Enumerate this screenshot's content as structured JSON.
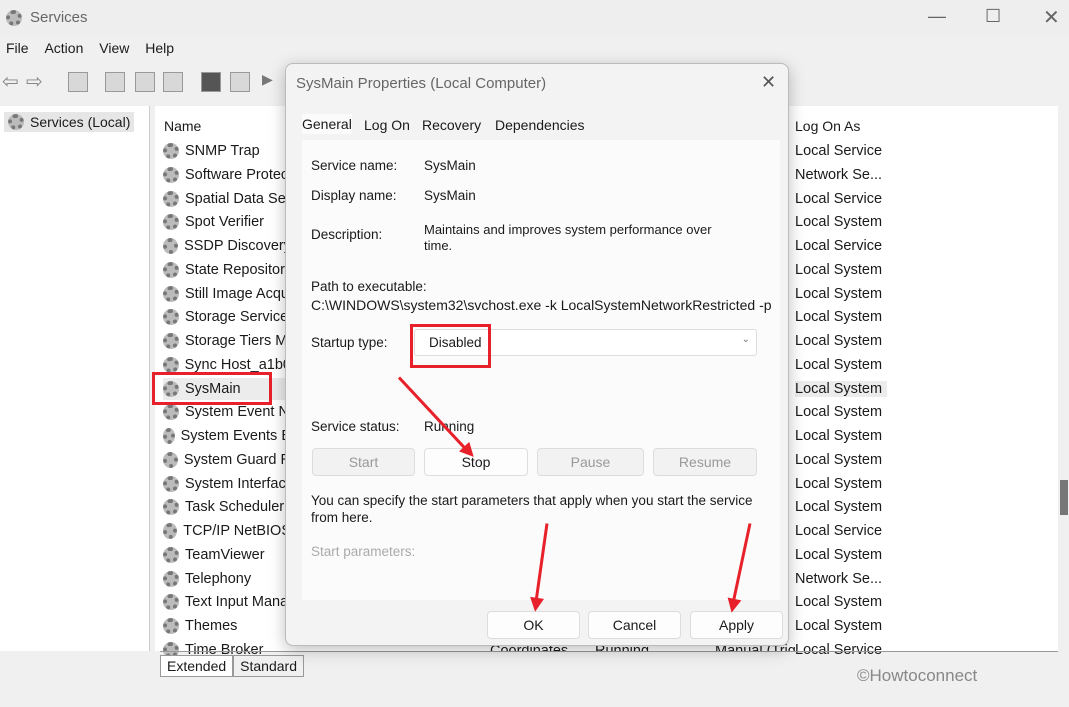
{
  "window": {
    "title": "Services",
    "menu": [
      "File",
      "Action",
      "View",
      "Help"
    ]
  },
  "tree": {
    "root": "Services (Local)"
  },
  "list": {
    "col_name": "Name",
    "col_logon": "Log On As",
    "rows": [
      {
        "name": "SNMP Trap",
        "logon": "Local Service"
      },
      {
        "name": "Software Protec",
        "logon": "Network Se..."
      },
      {
        "name": "Spatial Data Ser",
        "logon": "Local Service"
      },
      {
        "name": "Spot Verifier",
        "logon": "Local System"
      },
      {
        "name": "SSDP Discovery",
        "logon": "Local Service"
      },
      {
        "name": "State Repositor",
        "logon": "Local System"
      },
      {
        "name": "Still Image Acqu",
        "logon": "Local System"
      },
      {
        "name": "Storage Service",
        "logon": "Local System"
      },
      {
        "name": "Storage Tiers M",
        "logon": "Local System"
      },
      {
        "name": "Sync Host_a1b0",
        "logon": "Local System"
      },
      {
        "name": "SysMain",
        "logon": "Local System"
      },
      {
        "name": "System Event N",
        "logon": "Local System"
      },
      {
        "name": "System Events B",
        "logon": "Local System"
      },
      {
        "name": "System Guard R",
        "logon": "Local System"
      },
      {
        "name": "System Interfac",
        "logon": "Local System"
      },
      {
        "name": "Task Scheduler",
        "logon": "Local System"
      },
      {
        "name": "TCP/IP NetBIOS",
        "logon": "Local Service"
      },
      {
        "name": "TeamViewer",
        "logon": "Local System"
      },
      {
        "name": "Telephony",
        "logon": "Network Se..."
      },
      {
        "name": "Text Input Mana",
        "logon": "Local System"
      },
      {
        "name": "Themes",
        "logon": "Local System"
      },
      {
        "name": "Time Broker",
        "logon": "Local Service"
      }
    ],
    "partial_row": {
      "desc": "Coordinates",
      "status": "Running",
      "startup": "Manual (Trig"
    }
  },
  "tabs_bottom": [
    "Extended",
    "Standard"
  ],
  "dialog": {
    "title": "SysMain Properties (Local Computer)",
    "tabs": [
      "General",
      "Log On",
      "Recovery",
      "Dependencies"
    ],
    "service_name_label": "Service name:",
    "service_name": "SysMain",
    "display_name_label": "Display name:",
    "display_name": "SysMain",
    "description_label": "Description:",
    "description": "Maintains and improves system performance over time.",
    "path_label": "Path to executable:",
    "path": "C:\\WINDOWS\\system32\\svchost.exe -k LocalSystemNetworkRestricted -p",
    "startup_label": "Startup type:",
    "startup_value": "Disabled",
    "status_label": "Service status:",
    "status_value": "Running",
    "buttons": {
      "start": "Start",
      "stop": "Stop",
      "pause": "Pause",
      "resume": "Resume"
    },
    "params_note": "You can specify the start parameters that apply when you start the service from here.",
    "params_label": "Start parameters:",
    "ok": "OK",
    "cancel": "Cancel",
    "apply": "Apply"
  },
  "watermark": "©Howtoconnect",
  "colors": {
    "highlight": "#e8202a"
  }
}
